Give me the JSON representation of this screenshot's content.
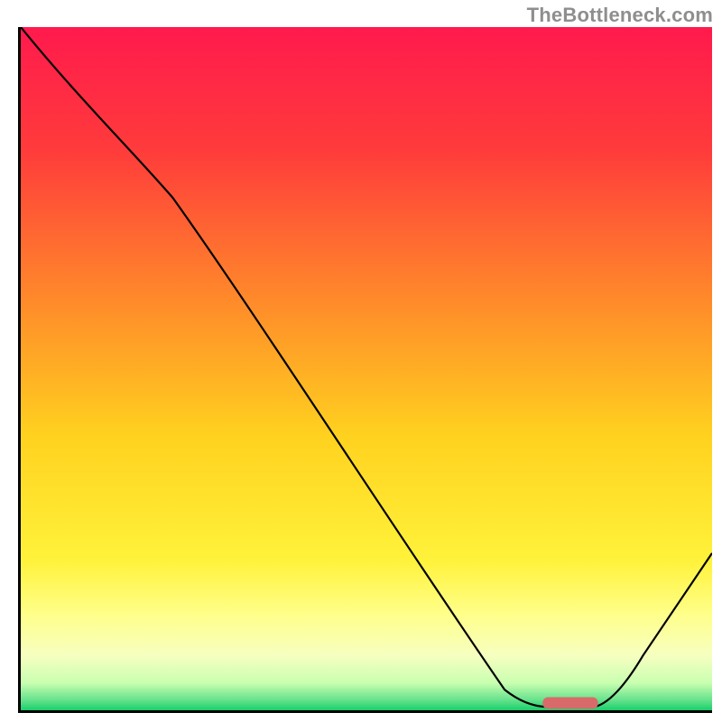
{
  "watermark": "TheBottleneck.com",
  "chart_data": {
    "type": "line",
    "title": "",
    "xlabel": "",
    "ylabel": "",
    "xlim": [
      0,
      100
    ],
    "ylim": [
      0,
      100
    ],
    "grid": false,
    "background_gradient": {
      "stops": [
        {
          "offset": 0.0,
          "color": "#ff1a4d"
        },
        {
          "offset": 0.18,
          "color": "#ff3b3b"
        },
        {
          "offset": 0.4,
          "color": "#ff8a2a"
        },
        {
          "offset": 0.6,
          "color": "#ffd21f"
        },
        {
          "offset": 0.78,
          "color": "#fff23a"
        },
        {
          "offset": 0.86,
          "color": "#ffff8a"
        },
        {
          "offset": 0.92,
          "color": "#f6ffc0"
        },
        {
          "offset": 0.96,
          "color": "#c9ffb0"
        },
        {
          "offset": 0.985,
          "color": "#66e28c"
        },
        {
          "offset": 1.0,
          "color": "#18cf6a"
        }
      ]
    },
    "curve": {
      "x": [
        0,
        22,
        70,
        76,
        83,
        100
      ],
      "y": [
        100,
        75,
        3,
        0.5,
        0.5,
        23
      ],
      "note": "y=0 is the green bottom (optimum); y=100 is the red top."
    },
    "marker": {
      "shape": "rounded-bar",
      "x_start": 75.5,
      "x_end": 83.5,
      "y": 0.6,
      "color": "#d96a6a"
    }
  }
}
